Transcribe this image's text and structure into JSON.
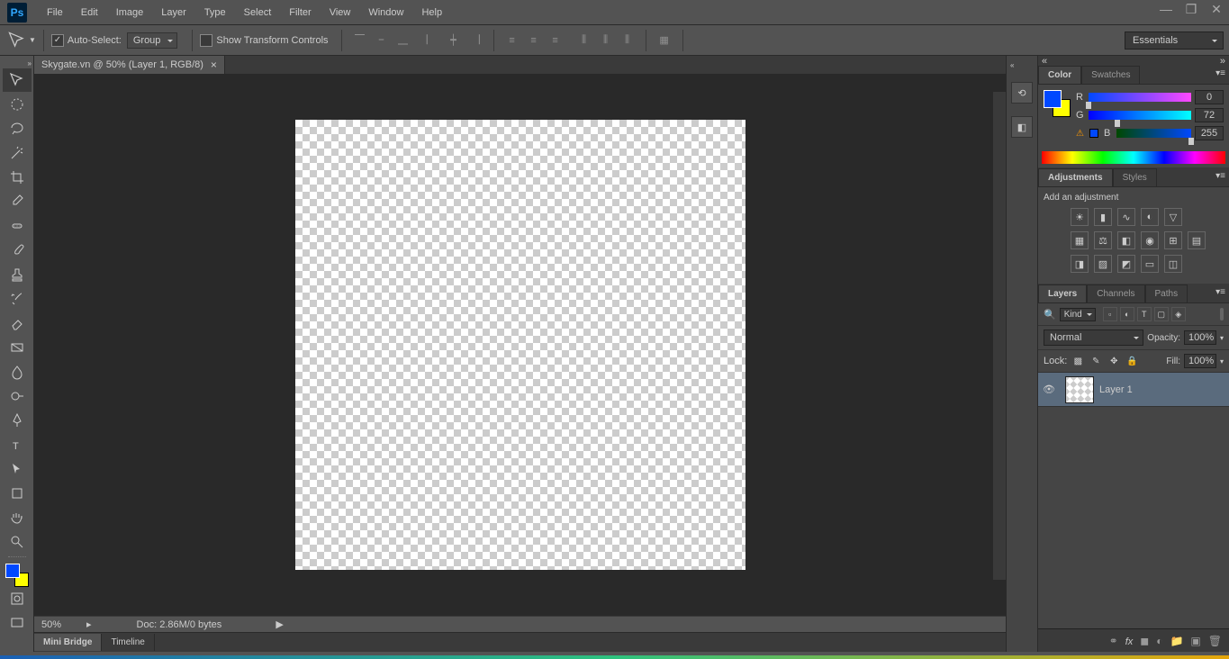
{
  "app": {
    "logo": "Ps"
  },
  "menu": [
    "File",
    "Edit",
    "Image",
    "Layer",
    "Type",
    "Select",
    "Filter",
    "View",
    "Window",
    "Help"
  ],
  "options": {
    "auto_select": "Auto-Select:",
    "group": "Group",
    "show_transform": "Show Transform Controls",
    "workspace": "Essentials"
  },
  "document": {
    "tab": "Skygate.vn @ 50% (Layer 1, RGB/8)",
    "zoom": "50%",
    "info": "Doc: 2.86M/0 bytes"
  },
  "bottom_tabs": [
    "Mini Bridge",
    "Timeline"
  ],
  "color": {
    "tab1": "Color",
    "tab2": "Swatches",
    "r_label": "R",
    "r_val": "0",
    "g_label": "G",
    "g_val": "72",
    "b_label": "B",
    "b_val": "255"
  },
  "adjustments": {
    "tab1": "Adjustments",
    "tab2": "Styles",
    "title": "Add an adjustment"
  },
  "layers": {
    "tab1": "Layers",
    "tab2": "Channels",
    "tab3": "Paths",
    "kind_icon": "🔍",
    "kind": "Kind",
    "blend": "Normal",
    "opacity_label": "Opacity:",
    "opacity": "100%",
    "lock_label": "Lock:",
    "fill_label": "Fill:",
    "fill": "100%",
    "layer1": "Layer 1"
  }
}
